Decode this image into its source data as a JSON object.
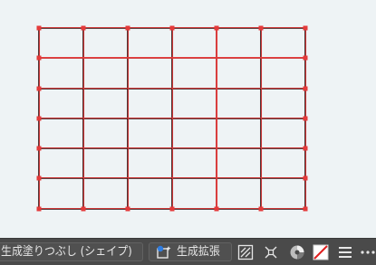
{
  "canvas": {
    "grid_columns": 6,
    "grid_rows": 6,
    "grid_color": "#2b0a0a",
    "selection_color": "#e43a3a",
    "background": "#eef3f5"
  },
  "toolbar": {
    "generative_fill_label": "生成塗りつぶし (シェイプ)",
    "generative_expand_label": "生成拡張",
    "icons": [
      "generative-expand-icon",
      "transparency-icon",
      "transform-icon",
      "color-wheel-icon",
      "no-fill-swatch-icon",
      "menu-icon",
      "more-options-icon"
    ],
    "background": "#4a4a4a"
  }
}
